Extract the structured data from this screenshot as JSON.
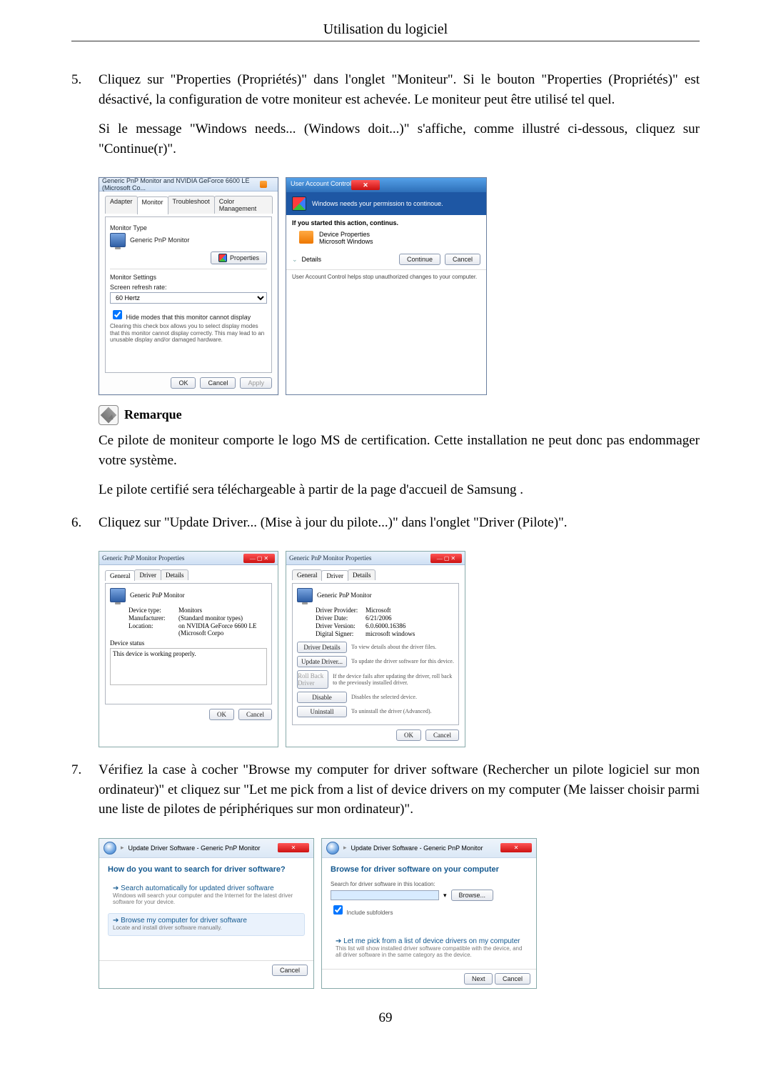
{
  "doc": {
    "header": "Utilisation du logiciel",
    "pagenum": "69",
    "item5": {
      "num": "5.",
      "p1": "Cliquez sur \"Properties (Propriétés)\" dans l'onglet \"Moniteur\". Si le bouton \"Properties (Propriétés)\" est désactivé, la configuration de votre moniteur est achevée. Le moniteur peut être utilisé tel quel.",
      "p2": "Si le message \"Windows needs... (Windows doit...)\" s'affiche, comme illustré ci-dessous, cliquez sur \"Continue(r)\"."
    },
    "note": {
      "title": "Remarque",
      "p1": "Ce pilote de moniteur comporte le logo MS de certification. Cette installation ne peut donc pas endommager votre système.",
      "p2": "Le pilote certifié sera téléchargeable à partir de la page d'accueil de Samsung ."
    },
    "item6": {
      "num": "6.",
      "p1": "Cliquez sur \"Update Driver... (Mise à jour du pilote...)\" dans l'onglet \"Driver (Pilote)\"."
    },
    "item7": {
      "num": "7.",
      "p1": "Vérifiez la case à cocher \"Browse my computer for driver software (Rechercher un pilote logiciel sur mon ordinateur)\" et cliquez sur \"Let me pick from a list of device drivers on my computer (Me laisser choisir parmi une liste de pilotes de périphériques sur mon ordinateur)\"."
    }
  },
  "dlg1": {
    "title": "Generic PnP Monitor and NVIDIA GeForce 6600 LE (Microsoft Co...",
    "tabs": {
      "adapter": "Adapter",
      "monitor": "Monitor",
      "trouble": "Troubleshoot",
      "color": "Color Management"
    },
    "monitor_type_lbl": "Monitor Type",
    "monitor_name": "Generic PnP Monitor",
    "properties_btn": "Properties",
    "monitor_settings_lbl": "Monitor Settings",
    "refresh_lbl": "Screen refresh rate:",
    "refresh_val": "60 Hertz",
    "hide_chk": "Hide modes that this monitor cannot display",
    "hide_desc": "Clearing this check box allows you to select display modes that this monitor cannot display correctly. This may lead to an unusable display and/or damaged hardware.",
    "ok": "OK",
    "cancel": "Cancel",
    "apply": "Apply"
  },
  "uac": {
    "title": "User Account Control",
    "headline": "Windows needs your permission to continoue.",
    "started": "If you started this action, continus.",
    "app": "Device Properties",
    "publisher": "Microsoft Windows",
    "details": "Details",
    "continue": "Continue",
    "cancel": "Cancel",
    "footer": "User Account Control helps stop unauthorized changes to your computer."
  },
  "props_general": {
    "title": "Generic PnP Monitor Properties",
    "tabs": {
      "general": "General",
      "driver": "Driver",
      "details": "Details"
    },
    "name": "Generic PnP Monitor",
    "devtype_k": "Device type:",
    "devtype_v": "Monitors",
    "manu_k": "Manufacturer:",
    "manu_v": "(Standard monitor types)",
    "loc_k": "Location:",
    "loc_v": "on NVIDIA GeForce 6600 LE (Microsoft Corpo",
    "status_lbl": "Device status",
    "status_txt": "This device is working properly.",
    "ok": "OK",
    "cancel": "Cancel"
  },
  "props_driver": {
    "title": "Generic PnP Monitor Properties",
    "tabs": {
      "general": "General",
      "driver": "Driver",
      "details": "Details"
    },
    "name": "Generic PnP Monitor",
    "prov_k": "Driver Provider:",
    "prov_v": "Microsoft",
    "date_k": "Driver Date:",
    "date_v": "6/21/2006",
    "ver_k": "Driver Version:",
    "ver_v": "6.0.6000.16386",
    "sign_k": "Digital Signer:",
    "sign_v": "microsoft windows",
    "btn_details": "Driver Details",
    "btn_details_d": "To view details about the driver files.",
    "btn_update": "Update Driver...",
    "btn_update_d": "To update the driver software for this device.",
    "btn_roll": "Roll Back Driver",
    "btn_roll_d": "If the device fails after updating the driver, roll back to the previously installed driver.",
    "btn_disable": "Disable",
    "btn_disable_d": "Disables the selected device.",
    "btn_uninstall": "Uninstall",
    "btn_uninstall_d": "To uninstall the driver (Advanced).",
    "ok": "OK",
    "cancel": "Cancel"
  },
  "wiz1": {
    "crumb": "Update Driver Software - Generic PnP Monitor",
    "heading": "How do you want to search for driver software?",
    "opt1_t": "Search automatically for updated driver software",
    "opt1_s": "Windows will search your computer and the Internet for the latest driver software for your device.",
    "opt2_t": "Browse my computer for driver software",
    "opt2_s": "Locate and install driver software manually.",
    "cancel": "Cancel"
  },
  "wiz2": {
    "crumb": "Update Driver Software - Generic PnP Monitor",
    "heading": "Browse for driver software on your computer",
    "search_lbl": "Search for driver software in this location:",
    "browse": "Browse...",
    "include": "Include subfolders",
    "opt_t": "Let me pick from a list of device drivers on my computer",
    "opt_s": "This list will show installed driver software compatible with the device, and all driver software in the same category as the device.",
    "next": "Next",
    "cancel": "Cancel"
  }
}
